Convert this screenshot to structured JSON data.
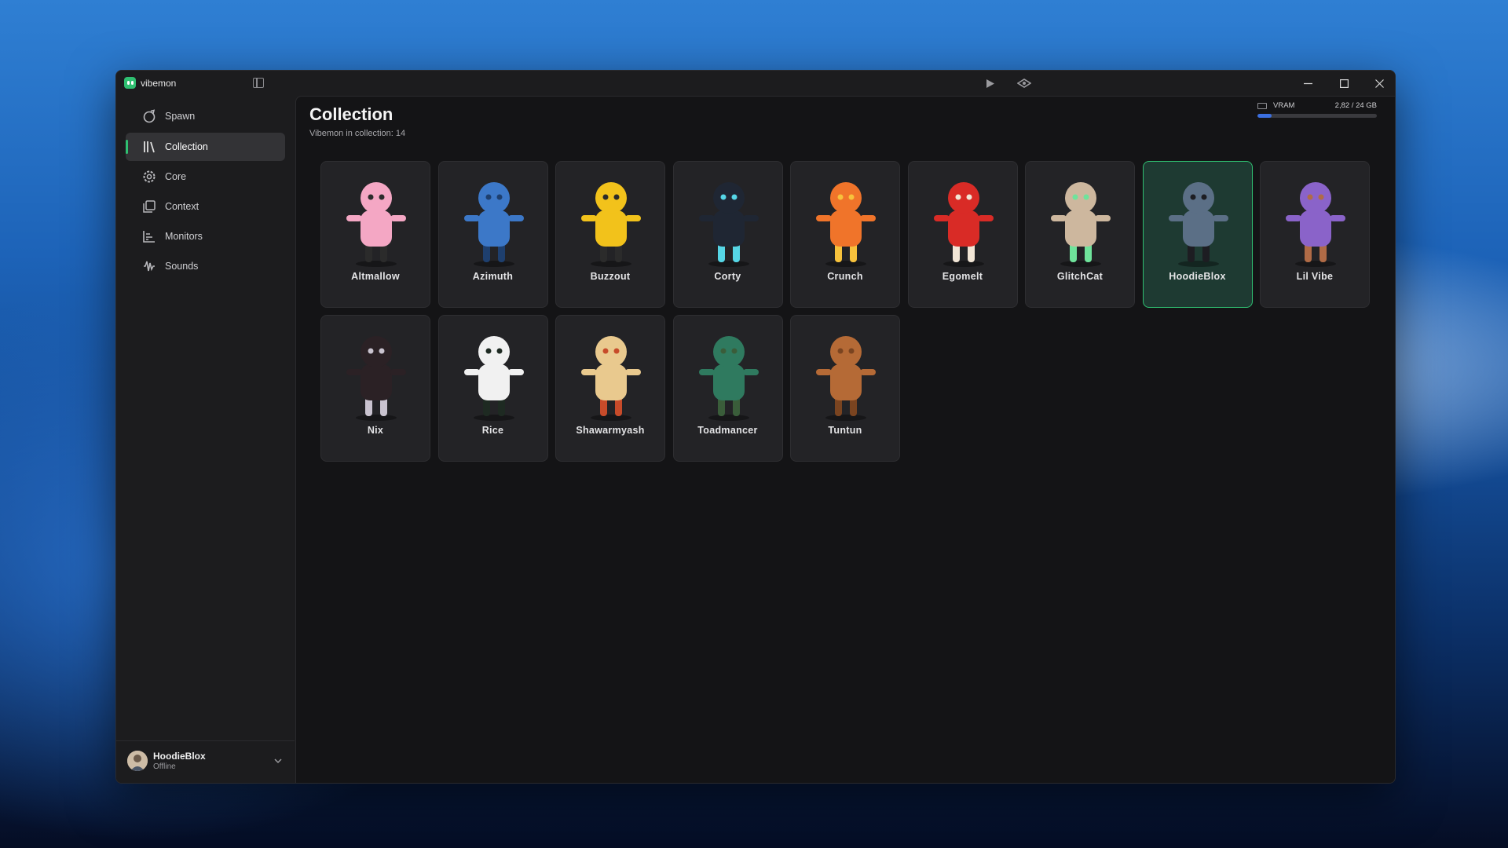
{
  "app": {
    "title": "vibemon"
  },
  "sidebar": {
    "items": [
      {
        "label": "Spawn",
        "icon": "spawn-icon",
        "active": false
      },
      {
        "label": "Collection",
        "icon": "library-icon",
        "active": true
      },
      {
        "label": "Core",
        "icon": "gear-icon",
        "active": false
      },
      {
        "label": "Context",
        "icon": "stack-icon",
        "active": false
      },
      {
        "label": "Monitors",
        "icon": "chart-icon",
        "active": false
      },
      {
        "label": "Sounds",
        "icon": "waveform-icon",
        "active": false
      }
    ]
  },
  "user": {
    "name": "HoodieBlox",
    "status": "Offline"
  },
  "header": {
    "title": "Collection",
    "subtitle": "Vibemon in collection: 14"
  },
  "vram": {
    "label": "VRAM",
    "value": "2,82 / 24 GB",
    "used_fraction": 0.1175,
    "color": "#3b6fe0"
  },
  "accent": "#2fbf71",
  "collection": [
    {
      "name": "Altmallow",
      "color": "#f4a7c4",
      "accent": "#2b2b2b",
      "selected": false
    },
    {
      "name": "Azimuth",
      "color": "#3c78c8",
      "accent": "#1e3f6e",
      "selected": false
    },
    {
      "name": "Buzzout",
      "color": "#f2c21b",
      "accent": "#2b2b2b",
      "selected": false
    },
    {
      "name": "Corty",
      "color": "#1f2633",
      "accent": "#56d6e6",
      "selected": false
    },
    {
      "name": "Crunch",
      "color": "#f0742a",
      "accent": "#f7c23c",
      "selected": false
    },
    {
      "name": "Egomelt",
      "color": "#d92b26",
      "accent": "#f2e6d6",
      "selected": false
    },
    {
      "name": "GlitchCat",
      "color": "#cdb79e",
      "accent": "#6fe39b",
      "selected": false
    },
    {
      "name": "HoodieBlox",
      "color": "#5b6f86",
      "accent": "#1d1d22",
      "selected": true
    },
    {
      "name": "Lil Vibe",
      "color": "#8a63c9",
      "accent": "#b06b46",
      "selected": false
    },
    {
      "name": "Nix",
      "color": "#2b2125",
      "accent": "#c9c3cf",
      "selected": false
    },
    {
      "name": "Rice",
      "color": "#f1f1f1",
      "accent": "#1e2a22",
      "selected": false
    },
    {
      "name": "Shawarmyash",
      "color": "#e9c98e",
      "accent": "#c74b2a",
      "selected": false
    },
    {
      "name": "Toadmancer",
      "color": "#2f7a5f",
      "accent": "#3a5d3a",
      "selected": false
    },
    {
      "name": "Tuntun",
      "color": "#b56a36",
      "accent": "#7a4420",
      "selected": false
    }
  ]
}
